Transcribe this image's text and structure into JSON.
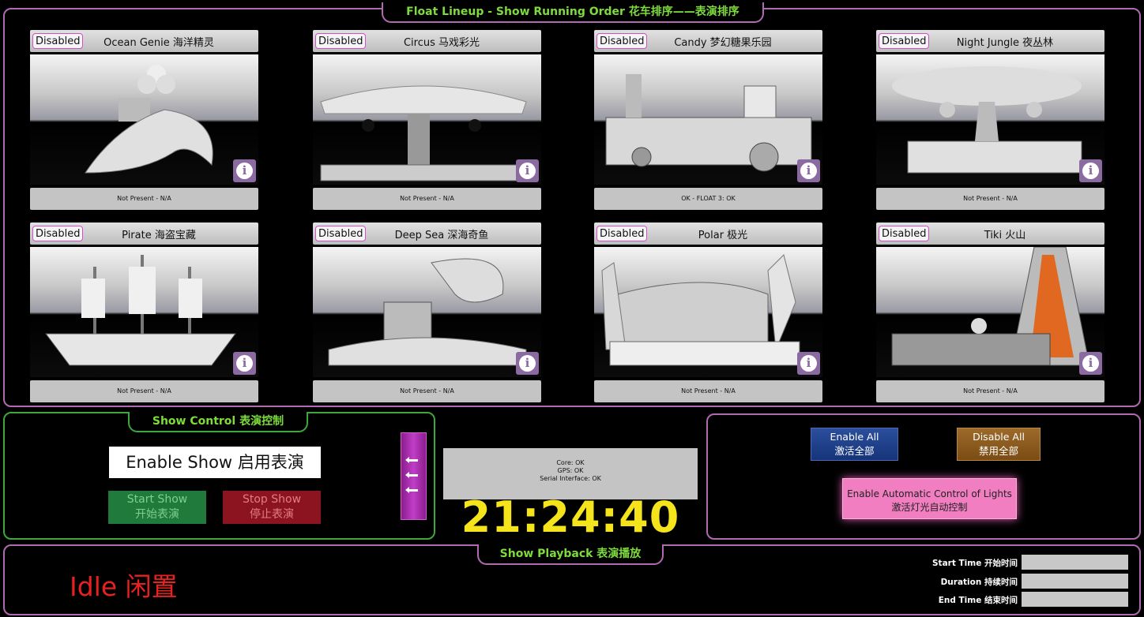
{
  "lineup": {
    "title": "Float Lineup - Show Running Order 花车排序——表演排序",
    "floats": [
      {
        "disabled_label": "Disabled",
        "name": "Ocean Genie 海洋精灵",
        "status": "Not Present - N/A"
      },
      {
        "disabled_label": "Disabled",
        "name": "Circus 马戏彩光",
        "status": "Not Present - N/A"
      },
      {
        "disabled_label": "Disabled",
        "name": "Candy 梦幻糖果乐园",
        "status": "OK - FLOAT 3: OK"
      },
      {
        "disabled_label": "Disabled",
        "name": "Night Jungle 夜丛林",
        "status": "Not Present - N/A"
      },
      {
        "disabled_label": "Disabled",
        "name": "Pirate 海盗宝藏",
        "status": "Not Present - N/A"
      },
      {
        "disabled_label": "Disabled",
        "name": "Deep Sea 深海奇鱼",
        "status": "Not Present - N/A"
      },
      {
        "disabled_label": "Disabled",
        "name": "Polar 极光",
        "status": "Not Present - N/A"
      },
      {
        "disabled_label": "Disabled",
        "name": "Tiki 火山",
        "status": "Not Present - N/A"
      }
    ],
    "info_icon": "info-icon"
  },
  "show_control": {
    "title": "Show Control 表演控制",
    "enable_show": "Enable Show 启用表演",
    "start": {
      "line1": "Start Show",
      "line2": "开始表演"
    },
    "stop": {
      "line1": "Stop Show",
      "line2": "停止表演"
    }
  },
  "system": {
    "status_lines": [
      "Core: OK",
      "GPS: OK",
      "Serial Interface: OK"
    ],
    "clock": "21:24:40"
  },
  "lights": {
    "enable_all": {
      "line1": "Enable All",
      "line2": "激活全部"
    },
    "disable_all": {
      "line1": "Disable All",
      "line2": "禁用全部"
    },
    "auto": {
      "line1": "Enable Automatic Control of Lights",
      "line2": "激活灯光自动控制"
    }
  },
  "playback": {
    "title": "Show Playback 表演播放",
    "state": "Idle 闲置",
    "start_time_label": "Start Time 开始时间",
    "duration_label": "Duration 持续时间",
    "end_time_label": "End Time 结束时间",
    "start_time_value": "",
    "duration_value": "",
    "end_time_value": ""
  },
  "colors": {
    "accent_frame": "#b06ab0",
    "title_green": "#7ddc3c",
    "clock_yellow": "#f5e31c",
    "idle_red": "#e8211e"
  }
}
